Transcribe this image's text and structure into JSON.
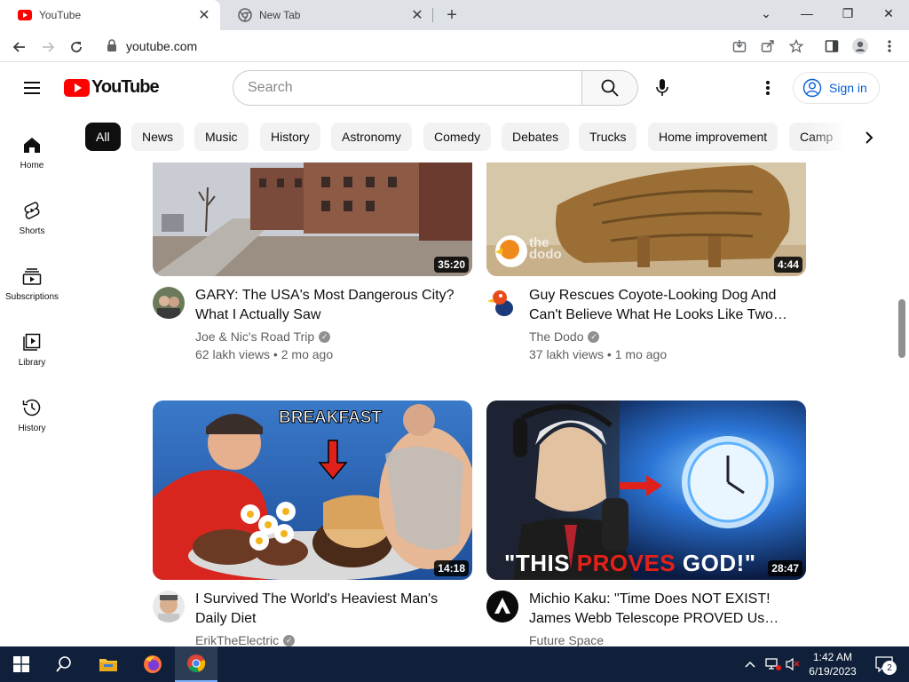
{
  "browser": {
    "tabs": [
      {
        "title": "YouTube",
        "active": true,
        "icon": "youtube-favicon"
      },
      {
        "title": "New Tab",
        "active": false,
        "icon": "chrome-favicon"
      }
    ],
    "new_tab_symbol": "+",
    "url": "youtube.com",
    "window_controls": {
      "tab_search": "⌄",
      "minimize": "—",
      "restore": "❐",
      "close": "✕"
    }
  },
  "header": {
    "logo_text": "YouTube",
    "search_placeholder": "Search",
    "signin_label": "Sign in"
  },
  "chips": [
    "All",
    "News",
    "Music",
    "History",
    "Astronomy",
    "Comedy",
    "Debates",
    "Trucks",
    "Home improvement",
    "Camp"
  ],
  "sidebar": {
    "items": [
      {
        "label": "Home",
        "icon": "home-icon"
      },
      {
        "label": "Shorts",
        "icon": "shorts-icon"
      },
      {
        "label": "Subscriptions",
        "icon": "subscriptions-icon"
      },
      {
        "label": "Library",
        "icon": "library-icon"
      },
      {
        "label": "History",
        "icon": "history-icon"
      }
    ]
  },
  "videos": [
    {
      "title": "GARY: The USA's Most Dangerous City? What I Actually Saw",
      "channel": "Joe & Nic's Road Trip",
      "verified": true,
      "views": "62 lakh views",
      "age": "2 mo ago",
      "duration": "35:20"
    },
    {
      "title": "Guy Rescues Coyote-Looking Dog And Can't Believe What He Looks Like Two…",
      "channel": "The Dodo",
      "verified": true,
      "views": "37 lakh views",
      "age": "1 mo ago",
      "duration": "4:44",
      "thumb_watermark": "the dodo"
    },
    {
      "title": "I Survived The World's Heaviest Man's Daily Diet",
      "channel": "ErikTheElectric",
      "verified": true,
      "duration": "14:18",
      "thumb_text": "BREAKFAST"
    },
    {
      "title": "Michio Kaku: \"Time Does NOT EXIST! James Webb Telescope PROVED Us…",
      "channel": "Future Space",
      "verified": false,
      "duration": "28:47",
      "thumb_text_parts": [
        "\"THIS ",
        "PROVES",
        " GOD!\""
      ]
    }
  ],
  "taskbar": {
    "time": "1:42 AM",
    "date": "6/19/2023",
    "notification_count": "2"
  },
  "colors": {
    "yt_red": "#ff0000",
    "link_blue": "#065fd4",
    "taskbar": "#10203a"
  }
}
